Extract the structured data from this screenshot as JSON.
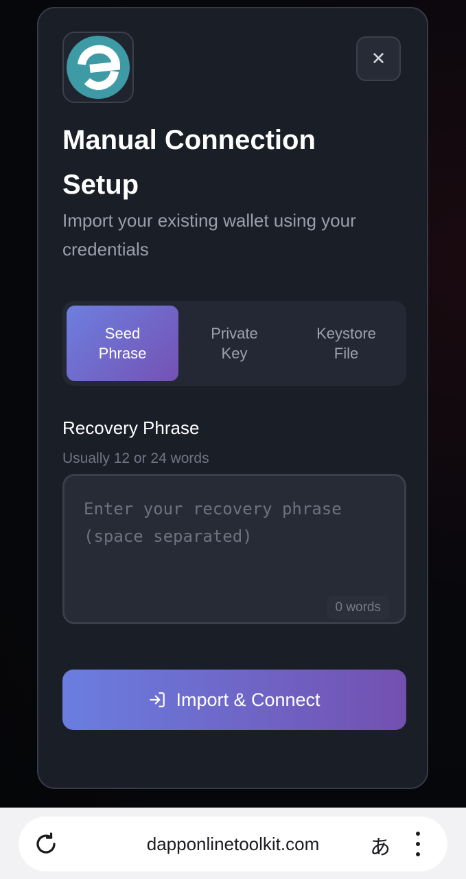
{
  "modal": {
    "title": "Manual Connection Setup",
    "subtitle": "Import your existing wallet using your credentials",
    "close_icon": "close-icon",
    "close_label": "✕",
    "logo_icon": "wallet-logo-icon",
    "accent_color": "#6d7fe0",
    "accent_color_end": "#7452b3",
    "tabs": [
      {
        "label": "Seed Phrase",
        "active": true
      },
      {
        "label": "Private Key",
        "active": false
      },
      {
        "label": "Keystore File",
        "active": false
      }
    ],
    "field": {
      "label": "Recovery Phrase",
      "hint": "Usually 12 or 24 words",
      "placeholder": "Enter your recovery phrase (space separated)",
      "value": "",
      "word_count": "0 words"
    },
    "import_button": {
      "icon": "login-icon",
      "label": "Import & Connect"
    }
  },
  "browser": {
    "url": "dapponlinetoolkit.com",
    "reload_icon": "reload-icon",
    "translate_glyph": "あ",
    "menu_icon": "more-vertical-icon"
  }
}
